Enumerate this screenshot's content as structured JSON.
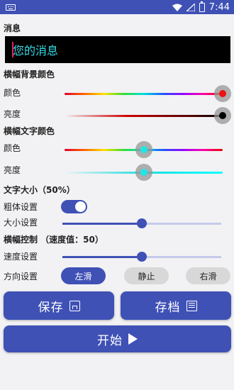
{
  "status_bar": {
    "time": "7:44"
  },
  "message": {
    "label": "消息",
    "value": "您的消息"
  },
  "banner_bg": {
    "label": "横幅背景颜色",
    "color_label": "颜色",
    "brightness_label": "亮度"
  },
  "banner_text": {
    "label": "横幅文字颜色",
    "color_label": "颜色",
    "brightness_label": "亮度"
  },
  "text_size": {
    "label": "文字大小（50%）",
    "bold_label": "粗体设置",
    "size_label": "大小设置",
    "bold_enabled": true,
    "size_level": 0.5
  },
  "banner_control": {
    "label": "横幅控制 （速度值：50）",
    "speed_label": "速度设置",
    "speed_level": 0.5,
    "direction_label": "方向设置",
    "direction_options": [
      "左滑",
      "静止",
      "右滑"
    ],
    "direction_selected": "左滑"
  },
  "buttons": {
    "save": "保存",
    "archive": "存档",
    "start": "开始"
  },
  "colors": {
    "accent": "#3f51b5",
    "message_text": "#33dde8",
    "bg_color_thumb": "#ee1111",
    "text_color_thumb": "#22e5e5"
  }
}
